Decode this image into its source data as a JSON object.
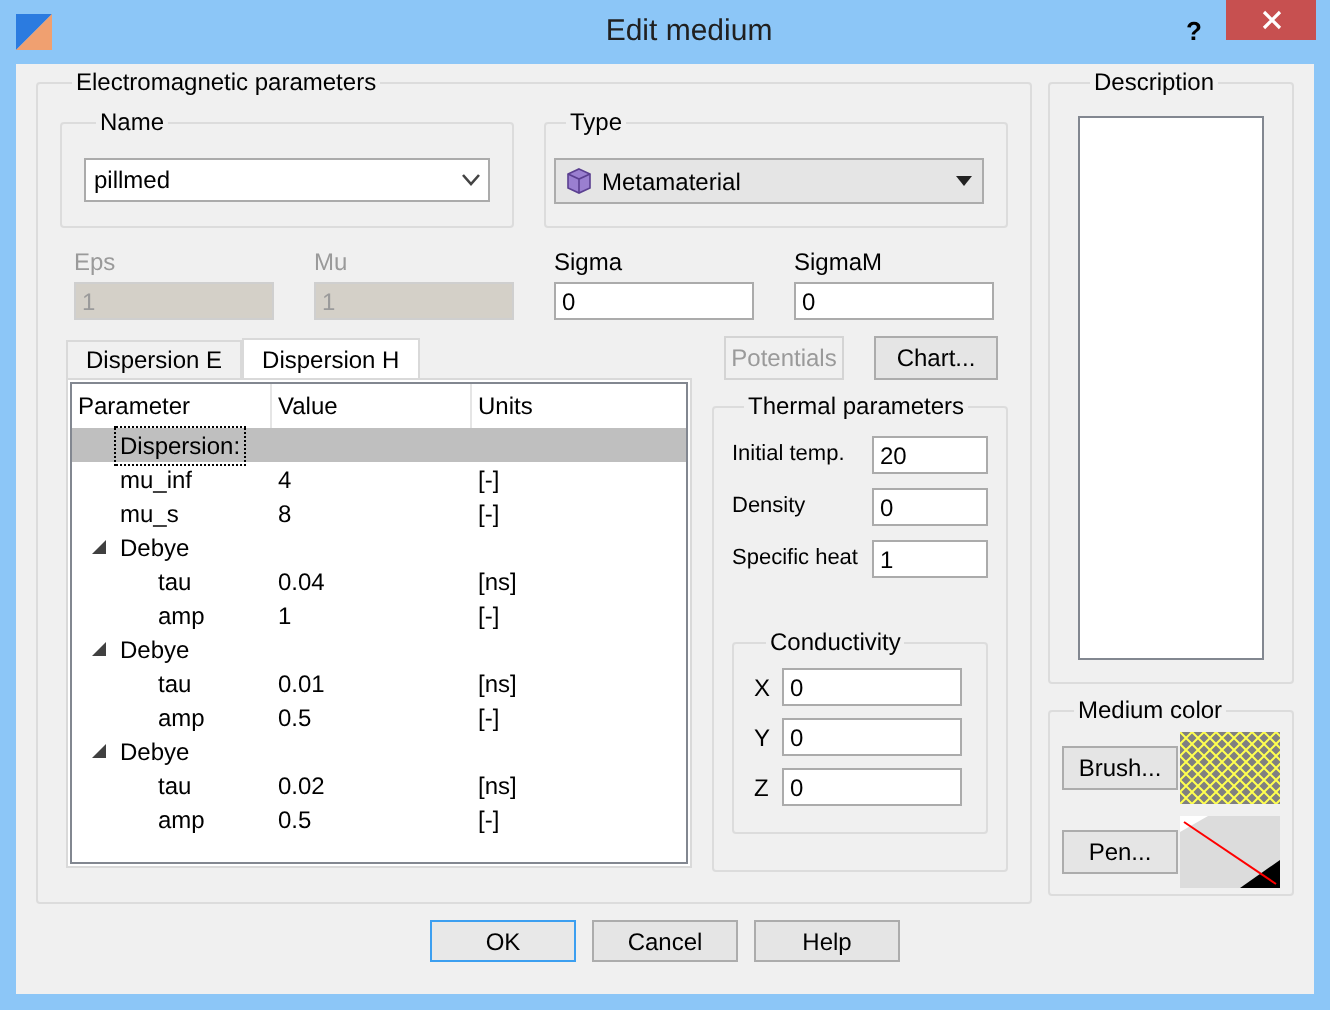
{
  "window": {
    "title": "Edit medium",
    "help": "?"
  },
  "em": {
    "title": "Electromagnetic parameters",
    "name": {
      "label": "Name",
      "value": "pillmed"
    },
    "type": {
      "label": "Type",
      "value": "Metamaterial"
    },
    "fields": [
      {
        "label": "Eps",
        "value": "1",
        "disabled": true
      },
      {
        "label": "Mu",
        "value": "1",
        "disabled": true
      },
      {
        "label": "Sigma",
        "value": "0",
        "disabled": false
      },
      {
        "label": "SigmaM",
        "value": "0",
        "disabled": false
      }
    ],
    "tabs": [
      {
        "label": "Dispersion E",
        "selected": false
      },
      {
        "label": "Dispersion H",
        "selected": true
      }
    ],
    "tree": {
      "columns": [
        "Parameter",
        "Value",
        "Units"
      ],
      "rows": [
        {
          "parameter": "Dispersion:",
          "selected": true
        },
        {
          "parameter": "mu_inf",
          "value": "4",
          "units": "[-]",
          "selected": false
        },
        {
          "parameter": "mu_s",
          "value": "8",
          "units": "[-]",
          "selected": false
        },
        {
          "parameter": "Debye",
          "expanded": true,
          "selected": false,
          "children": [
            {
              "parameter": "tau",
              "value": "0.04",
              "units": "[ns]",
              "selected": false
            },
            {
              "parameter": "amp",
              "value": "1",
              "units": "[-]",
              "selected": false
            }
          ]
        },
        {
          "parameter": "Debye",
          "expanded": true,
          "selected": false,
          "children": [
            {
              "parameter": "tau",
              "value": "0.01",
              "units": "[ns]",
              "selected": false
            },
            {
              "parameter": "amp",
              "value": "0.5",
              "units": "[-]",
              "selected": false
            }
          ]
        },
        {
          "parameter": "Debye",
          "expanded": true,
          "selected": false,
          "children": [
            {
              "parameter": "tau",
              "value": "0.02",
              "units": "[ns]",
              "selected": false
            },
            {
              "parameter": "amp",
              "value": "0.5",
              "units": "[-]",
              "selected": false
            }
          ]
        }
      ]
    },
    "buttons": [
      {
        "label": "Potentials",
        "disabled": true
      },
      {
        "label": "Chart...",
        "disabled": false
      }
    ],
    "thermal": {
      "title": "Thermal parameters",
      "fields": [
        {
          "label": "Initial temp.",
          "value": "20"
        },
        {
          "label": "Density",
          "value": "0"
        },
        {
          "label": "Specific heat",
          "value": "1"
        }
      ],
      "conductivity": {
        "title": "Conductivity",
        "fields": [
          {
            "label": "X",
            "value": "0"
          },
          {
            "label": "Y",
            "value": "0"
          },
          {
            "label": "Z",
            "value": "0"
          }
        ]
      }
    }
  },
  "description": {
    "title": "Description"
  },
  "medium_color": {
    "title": "Medium color",
    "buttons": [
      "Brush...",
      "Pen..."
    ]
  },
  "buttons": [
    {
      "label": "OK",
      "default": true
    },
    {
      "label": "Cancel",
      "default": false
    },
    {
      "label": "Help",
      "default": false
    }
  ]
}
